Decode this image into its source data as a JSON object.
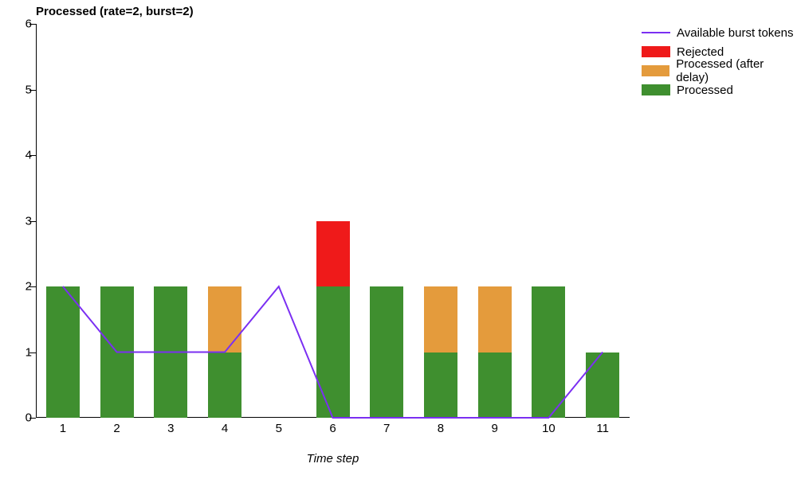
{
  "chart_data": {
    "type": "bar",
    "title": "Processed (rate=2, burst=2)",
    "xlabel": "Time step",
    "ylabel": "",
    "ylim": [
      0,
      6
    ],
    "categories": [
      "1",
      "2",
      "3",
      "4",
      "5",
      "6",
      "7",
      "8",
      "9",
      "10",
      "11"
    ],
    "series": [
      {
        "name": "Processed",
        "color": "#3f8f2f",
        "values": [
          2,
          2,
          2,
          1,
          0,
          2,
          2,
          1,
          1,
          2,
          1
        ]
      },
      {
        "name": "Processed (after delay)",
        "color": "#e49b3c",
        "values": [
          0,
          0,
          0,
          1,
          0,
          0,
          0,
          1,
          1,
          0,
          0
        ]
      },
      {
        "name": "Rejected",
        "color": "#ef1a1a",
        "values": [
          0,
          0,
          0,
          0,
          0,
          1,
          0,
          0,
          0,
          0,
          0
        ]
      }
    ],
    "line_series": {
      "name": "Available burst tokens",
      "color": "#7b2ff2",
      "values": [
        2,
        1,
        1,
        1,
        2,
        0,
        0,
        0,
        0,
        0,
        1
      ]
    },
    "y_ticks": [
      0,
      1,
      2,
      3,
      4,
      5,
      6
    ],
    "legend": [
      {
        "kind": "line",
        "label": "Available burst tokens",
        "color": "#7b2ff2"
      },
      {
        "kind": "swatch",
        "label": "Rejected",
        "color": "#ef1a1a"
      },
      {
        "kind": "swatch",
        "label": "Processed (after delay)",
        "color": "#e49b3c"
      },
      {
        "kind": "swatch",
        "label": "Processed",
        "color": "#3f8f2f"
      }
    ]
  }
}
